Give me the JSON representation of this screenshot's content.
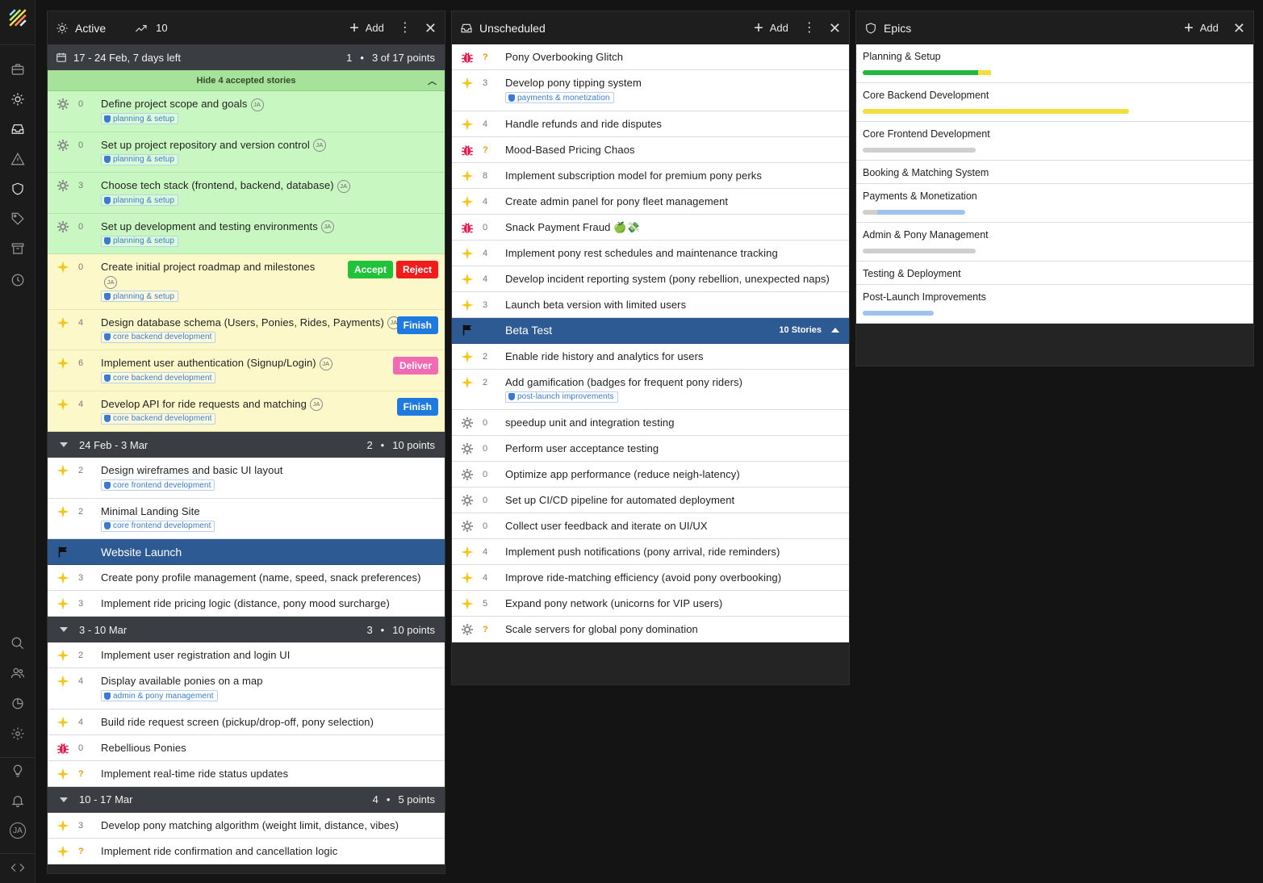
{
  "colors": {
    "feature": "#f5c518",
    "bug": "#e3194b",
    "chore": "#8a8a8a",
    "accepted": "#c8f7c1",
    "in_progress": "#fdf8c9",
    "release": "#2d5a93",
    "bar_green": "#21b83d",
    "bar_yellow": "#f2de3c",
    "bar_gray": "#cfcfcf",
    "bar_blue": "#9ec3ec"
  },
  "rail": {
    "icons": [
      "logo-icon",
      "briefcase-icon",
      "sun-icon",
      "inbox-icon",
      "warning-icon",
      "shield-icon",
      "tag-icon",
      "archive-icon",
      "clock-icon",
      "search-icon",
      "people-icon",
      "chart-icon",
      "gear-icon",
      "lightbulb-icon",
      "bell-icon",
      "avatar",
      "code-icon"
    ],
    "avatar_initials": "JA"
  },
  "active": {
    "title": "Active",
    "velocity": "10",
    "add_label": "Add",
    "iteration_current": {
      "range": "17 - 24 Feb, 7 days left",
      "number": "1",
      "points": "3 of 17 points"
    },
    "accepted_toggle": "Hide 4 accepted stories",
    "current_stories": [
      {
        "type": "chore",
        "points": "0",
        "title": "Define project scope and goals",
        "owner": "JA",
        "labels": [
          "planning & setup"
        ],
        "state": "green",
        "buttons": []
      },
      {
        "type": "chore",
        "points": "0",
        "title": "Set up project repository and version control",
        "owner": "JA",
        "labels": [
          "planning & setup"
        ],
        "state": "green",
        "buttons": []
      },
      {
        "type": "chore",
        "points": "3",
        "title": "Choose tech stack (frontend, backend, database)",
        "owner": "JA",
        "labels": [
          "planning & setup"
        ],
        "state": "green",
        "buttons": []
      },
      {
        "type": "chore",
        "points": "0",
        "title": "Set up development and testing environments",
        "owner": "JA",
        "labels": [
          "planning & setup"
        ],
        "state": "green",
        "buttons": []
      },
      {
        "type": "feature",
        "points": "0",
        "title": "Create initial project roadmap and milestones",
        "owner": "JA",
        "owner_newline": true,
        "labels": [
          "planning & setup"
        ],
        "state": "yellow",
        "buttons": [
          {
            "label": "Accept",
            "kind": "accept"
          },
          {
            "label": "Reject",
            "kind": "reject"
          }
        ]
      },
      {
        "type": "feature",
        "points": "4",
        "title": "Design database schema (Users, Ponies, Rides, Payments)",
        "owner": "JA",
        "labels": [
          "core backend development"
        ],
        "state": "yellow",
        "buttons": [
          {
            "label": "Finish",
            "kind": "finish"
          }
        ]
      },
      {
        "type": "feature",
        "points": "6",
        "title": "Implement user authentication (Signup/Login)",
        "owner": "JA",
        "labels": [
          "core backend development"
        ],
        "state": "yellow",
        "buttons": [
          {
            "label": "Deliver",
            "kind": "deliver"
          }
        ]
      },
      {
        "type": "feature",
        "points": "4",
        "title": "Develop API for ride requests and matching",
        "owner": "JA",
        "labels": [
          "core backend development"
        ],
        "state": "yellow",
        "buttons": [
          {
            "label": "Finish",
            "kind": "finish"
          }
        ]
      }
    ],
    "iterations": [
      {
        "range": "24 Feb - 3 Mar",
        "number": "2",
        "points": "10 points",
        "items": [
          {
            "type": "feature",
            "points": "2",
            "title": "Design wireframes and basic UI layout",
            "labels": [
              "core frontend development"
            ]
          },
          {
            "type": "feature",
            "points": "2",
            "title": "Minimal Landing Site",
            "labels": [
              "core frontend development"
            ]
          },
          {
            "type": "release",
            "title": "Website Launch"
          },
          {
            "type": "feature",
            "points": "3",
            "title": "Create pony profile management (name, speed, snack preferences)",
            "labels": []
          },
          {
            "type": "feature",
            "points": "3",
            "title": "Implement ride pricing logic (distance, pony mood surcharge)",
            "labels": []
          }
        ]
      },
      {
        "range": "3 - 10 Mar",
        "number": "3",
        "points": "10 points",
        "items": [
          {
            "type": "feature",
            "points": "2",
            "title": "Implement user registration and login UI",
            "labels": []
          },
          {
            "type": "feature",
            "points": "4",
            "title": "Display available ponies on a map",
            "labels": [
              "admin & pony management"
            ]
          },
          {
            "type": "feature",
            "points": "4",
            "title": "Build ride request screen (pickup/drop-off, pony selection)",
            "labels": []
          },
          {
            "type": "bug",
            "points": "0",
            "title": "Rebellious Ponies",
            "labels": []
          },
          {
            "type": "feature",
            "points": "?",
            "title": "Implement real-time ride status updates",
            "labels": []
          }
        ]
      },
      {
        "range": "10 - 17 Mar",
        "number": "4",
        "points": "5 points",
        "items": [
          {
            "type": "feature",
            "points": "3",
            "title": "Develop pony matching algorithm (weight limit, distance, vibes)",
            "labels": []
          },
          {
            "type": "feature",
            "points": "?",
            "title": "Implement ride confirmation and cancellation logic",
            "labels": []
          }
        ]
      }
    ]
  },
  "unscheduled": {
    "title": "Unscheduled",
    "add_label": "Add",
    "items": [
      {
        "type": "bug",
        "points": "?",
        "title": "Pony Overbooking Glitch",
        "labels": []
      },
      {
        "type": "feature",
        "points": "3",
        "title": "Develop pony tipping system",
        "labels": [
          "payments & monetization"
        ]
      },
      {
        "type": "feature",
        "points": "4",
        "title": "Handle refunds and ride disputes",
        "labels": []
      },
      {
        "type": "bug",
        "points": "?",
        "title": "Mood-Based Pricing Chaos",
        "labels": []
      },
      {
        "type": "feature",
        "points": "8",
        "title": "Implement subscription model for premium pony perks",
        "labels": []
      },
      {
        "type": "feature",
        "points": "4",
        "title": "Create admin panel for pony fleet management",
        "labels": []
      },
      {
        "type": "bug",
        "points": "0",
        "title": "Snack Payment Fraud 🍏💸",
        "labels": []
      },
      {
        "type": "feature",
        "points": "4",
        "title": "Implement pony rest schedules and maintenance tracking",
        "labels": []
      },
      {
        "type": "feature",
        "points": "4",
        "title": "Develop incident reporting system (pony rebellion, unexpected naps)",
        "labels": []
      },
      {
        "type": "feature",
        "points": "3",
        "title": "Launch beta version with limited users",
        "labels": []
      },
      {
        "type": "release",
        "title": "Beta Test",
        "count": "10 Stories"
      },
      {
        "type": "feature",
        "points": "2",
        "title": "Enable ride history and analytics for users",
        "labels": []
      },
      {
        "type": "feature",
        "points": "2",
        "title": "Add gamification (badges for frequent pony riders)",
        "labels": [
          "post-launch improvements"
        ]
      },
      {
        "type": "chore",
        "points": "0",
        "title": "speedup unit and integration testing",
        "labels": []
      },
      {
        "type": "chore",
        "points": "0",
        "title": "Perform user acceptance testing",
        "labels": []
      },
      {
        "type": "chore",
        "points": "0",
        "title": "Optimize app performance (reduce neigh-latency)",
        "labels": []
      },
      {
        "type": "chore",
        "points": "0",
        "title": "Set up CI/CD pipeline for automated deployment",
        "labels": []
      },
      {
        "type": "chore",
        "points": "0",
        "title": "Collect user feedback and iterate on UI/UX",
        "labels": []
      },
      {
        "type": "feature",
        "points": "4",
        "title": "Implement push notifications (pony arrival, ride reminders)",
        "labels": []
      },
      {
        "type": "feature",
        "points": "4",
        "title": "Improve ride-matching efficiency (avoid pony overbooking)",
        "labels": []
      },
      {
        "type": "feature",
        "points": "5",
        "title": "Expand pony network (unicorns for VIP users)",
        "labels": []
      },
      {
        "type": "chore",
        "points": "?",
        "title": "Scale servers for global pony domination",
        "labels": []
      }
    ]
  },
  "epics": {
    "title": "Epics",
    "add_label": "Add",
    "items": [
      {
        "name": "Planning & Setup",
        "progress": [
          {
            "c": "green",
            "v": 0.88
          },
          {
            "c": "yellow",
            "v": 0.1
          }
        ]
      },
      {
        "name": "Core Backend Development",
        "progress": [
          {
            "c": "yellow",
            "v": 1.0
          }
        ]
      },
      {
        "name": "Core Frontend Development",
        "progress": [
          {
            "c": "gray",
            "v": 1.0
          }
        ]
      },
      {
        "name": "Booking & Matching System",
        "progress": []
      },
      {
        "name": "Payments & Monetization",
        "progress": [
          {
            "c": "gray",
            "v": 0.14
          },
          {
            "c": "blue",
            "v": 0.86
          }
        ]
      },
      {
        "name": "Admin & Pony Management",
        "progress": [
          {
            "c": "gray",
            "v": 1.0
          }
        ]
      },
      {
        "name": "Testing & Deployment",
        "progress": []
      },
      {
        "name": "Post-Launch Improvements",
        "progress": [
          {
            "c": "blue",
            "v": 1.0
          }
        ]
      }
    ]
  }
}
